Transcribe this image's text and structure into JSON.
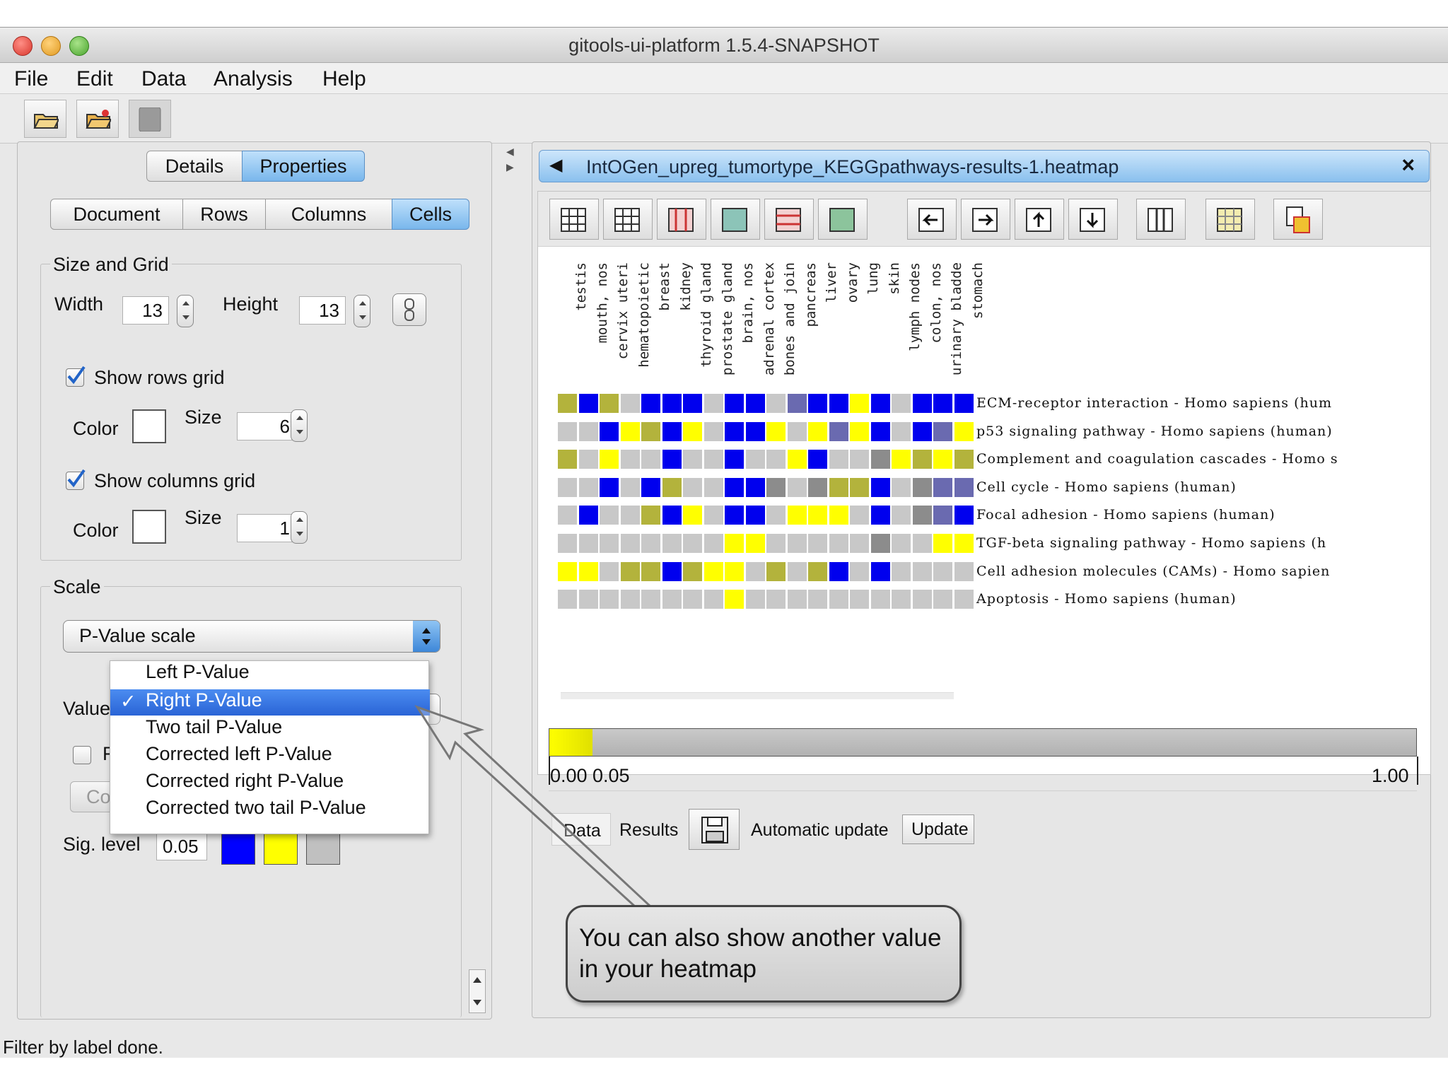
{
  "window": {
    "title": "gitools-ui-platform 1.5.4-SNAPSHOT"
  },
  "menu": [
    "File",
    "Edit",
    "Data",
    "Analysis",
    "Help"
  ],
  "left": {
    "tabs": [
      "Details",
      "Properties"
    ],
    "subtabs": [
      "Document",
      "Rows",
      "Columns",
      "Cells"
    ],
    "size_grid": {
      "title": "Size and Grid",
      "width_label": "Width",
      "width": "13",
      "height_label": "Height",
      "height": "13",
      "show_rows_grid": "Show rows grid",
      "color_label": "Color",
      "size_label": "Size",
      "rows_size": "6",
      "show_columns_grid": "Show columns grid",
      "cols_size": "1"
    },
    "scale": {
      "title": "Scale",
      "selected": "P-Value scale",
      "value_label": "Value",
      "options": [
        "Left P-Value",
        "Right P-Value",
        "Two tail P-Value",
        "Corrected left P-Value",
        "Corrected right P-Value",
        "Corrected two tail P-Value"
      ],
      "check_fragment": "F",
      "button_fragment": "Co",
      "sig_label": "Sig. level",
      "sig_value": "0.05",
      "colors": [
        "#0000ff",
        "#ffff00",
        "#c0c0c0"
      ]
    }
  },
  "right": {
    "doc_tab": "IntOGen_upreg_tumortype_KEGGpathways-results-1.heatmap",
    "close_label": "×",
    "columns": [
      "testis",
      "mouth, nos",
      "cervix uteri",
      "hematopoietic",
      "breast",
      "kidney",
      "thyroid gland",
      "prostate gland",
      "brain, nos",
      "adrenal cortex",
      "bones and join",
      "pancreas",
      "liver",
      "ovary",
      "lung",
      "skin",
      "lymph nodes",
      "colon, nos",
      "urinary bladde",
      "stomach"
    ],
    "rows": [
      {
        "label": "ECM-receptor interaction - Homo sapiens (hum",
        "cells": [
          "o",
          "b",
          "o",
          "g",
          "b",
          "b",
          "b",
          "g",
          "b",
          "b",
          "g",
          "s",
          "b",
          "b",
          "y",
          "b",
          "g",
          "b",
          "b",
          "b"
        ]
      },
      {
        "label": "p53 signaling pathway - Homo sapiens (human)",
        "cells": [
          "g",
          "g",
          "b",
          "y",
          "o",
          "b",
          "y",
          "g",
          "b",
          "b",
          "y",
          "g",
          "y",
          "s",
          "y",
          "b",
          "g",
          "b",
          "s",
          "y"
        ]
      },
      {
        "label": "Complement and coagulation cascades - Homo s",
        "cells": [
          "o",
          "g",
          "y",
          "g",
          "g",
          "b",
          "g",
          "g",
          "b",
          "g",
          "g",
          "y",
          "b",
          "g",
          "g",
          "d",
          "y",
          "o",
          "y",
          "o"
        ]
      },
      {
        "label": "Cell cycle - Homo sapiens (human)",
        "cells": [
          "g",
          "g",
          "b",
          "g",
          "b",
          "o",
          "g",
          "g",
          "b",
          "b",
          "d",
          "g",
          "d",
          "o",
          "o",
          "b",
          "g",
          "d",
          "s",
          "s"
        ]
      },
      {
        "label": "Focal adhesion - Homo sapiens (human)",
        "cells": [
          "g",
          "b",
          "g",
          "g",
          "o",
          "b",
          "y",
          "g",
          "b",
          "b",
          "g",
          "y",
          "y",
          "y",
          "g",
          "b",
          "g",
          "d",
          "s",
          "b"
        ]
      },
      {
        "label": "TGF-beta signaling pathway - Homo sapiens (h",
        "cells": [
          "g",
          "g",
          "g",
          "g",
          "g",
          "g",
          "g",
          "g",
          "y",
          "y",
          "g",
          "g",
          "g",
          "g",
          "g",
          "d",
          "g",
          "g",
          "y",
          "y"
        ]
      },
      {
        "label": "Cell adhesion molecules (CAMs) - Homo sapien",
        "cells": [
          "y",
          "y",
          "g",
          "o",
          "o",
          "b",
          "o",
          "y",
          "y",
          "g",
          "o",
          "g",
          "o",
          "b",
          "g",
          "b",
          "g",
          "g",
          "g",
          "g"
        ]
      },
      {
        "label": "Apoptosis - Homo sapiens (human)",
        "cells": [
          "g",
          "g",
          "g",
          "g",
          "g",
          "g",
          "g",
          "g",
          "y",
          "g",
          "g",
          "g",
          "g",
          "g",
          "g",
          "g",
          "g",
          "g",
          "g",
          "g"
        ]
      }
    ],
    "scale_min": "0.00",
    "scale_sig": "0.05",
    "scale_max": "1.00",
    "sig_fraction": 0.05,
    "bottom_tabs": [
      "Data",
      "Results"
    ],
    "auto_update": "Automatic update",
    "update": "Update"
  },
  "callout": "You can also show another value in your heatmap",
  "status": "Filter by label done.",
  "cell_colors": {
    "b": "#0000ee",
    "y": "#ffff00",
    "o": "#b3b33c",
    "g": "#c8c8c8",
    "s": "#6a6ab0",
    "d": "#8c8c8c"
  }
}
